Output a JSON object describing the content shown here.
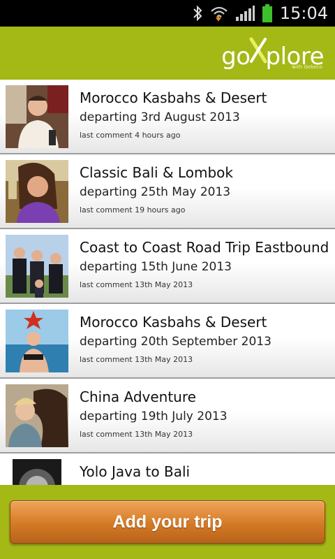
{
  "status_bar": {
    "time": "15:04",
    "icons": [
      "bluetooth-icon",
      "wifi-icon",
      "signal-icon",
      "battery-icon"
    ]
  },
  "header": {
    "logo_text_left": "go",
    "logo_text_right": "plore",
    "logo_sub": "with Gebeco"
  },
  "trips": [
    {
      "title": "Morocco Kasbahs & Desert",
      "departing": "departing 3rd August 2013",
      "last_comment": "last comment 4 hours ago"
    },
    {
      "title": "Classic Bali & Lombok",
      "departing": "departing 25th May 2013",
      "last_comment": "last comment 19 hours ago"
    },
    {
      "title": "Coast to Coast Road Trip Eastbound",
      "departing": "departing 15th June 2013",
      "last_comment": "last comment 13th May 2013"
    },
    {
      "title": "Morocco Kasbahs & Desert",
      "departing": "departing 20th September 2013",
      "last_comment": "last comment 13th May 2013"
    },
    {
      "title": "China Adventure",
      "departing": "departing 19th July 2013",
      "last_comment": "last comment 13th May 2013"
    },
    {
      "title": "Yolo Java to Bali",
      "departing": "",
      "last_comment": ""
    }
  ],
  "footer": {
    "add_button_label": "Add your trip"
  },
  "colors": {
    "brand_green": "#a4b816",
    "button_orange": "#d47a26"
  }
}
